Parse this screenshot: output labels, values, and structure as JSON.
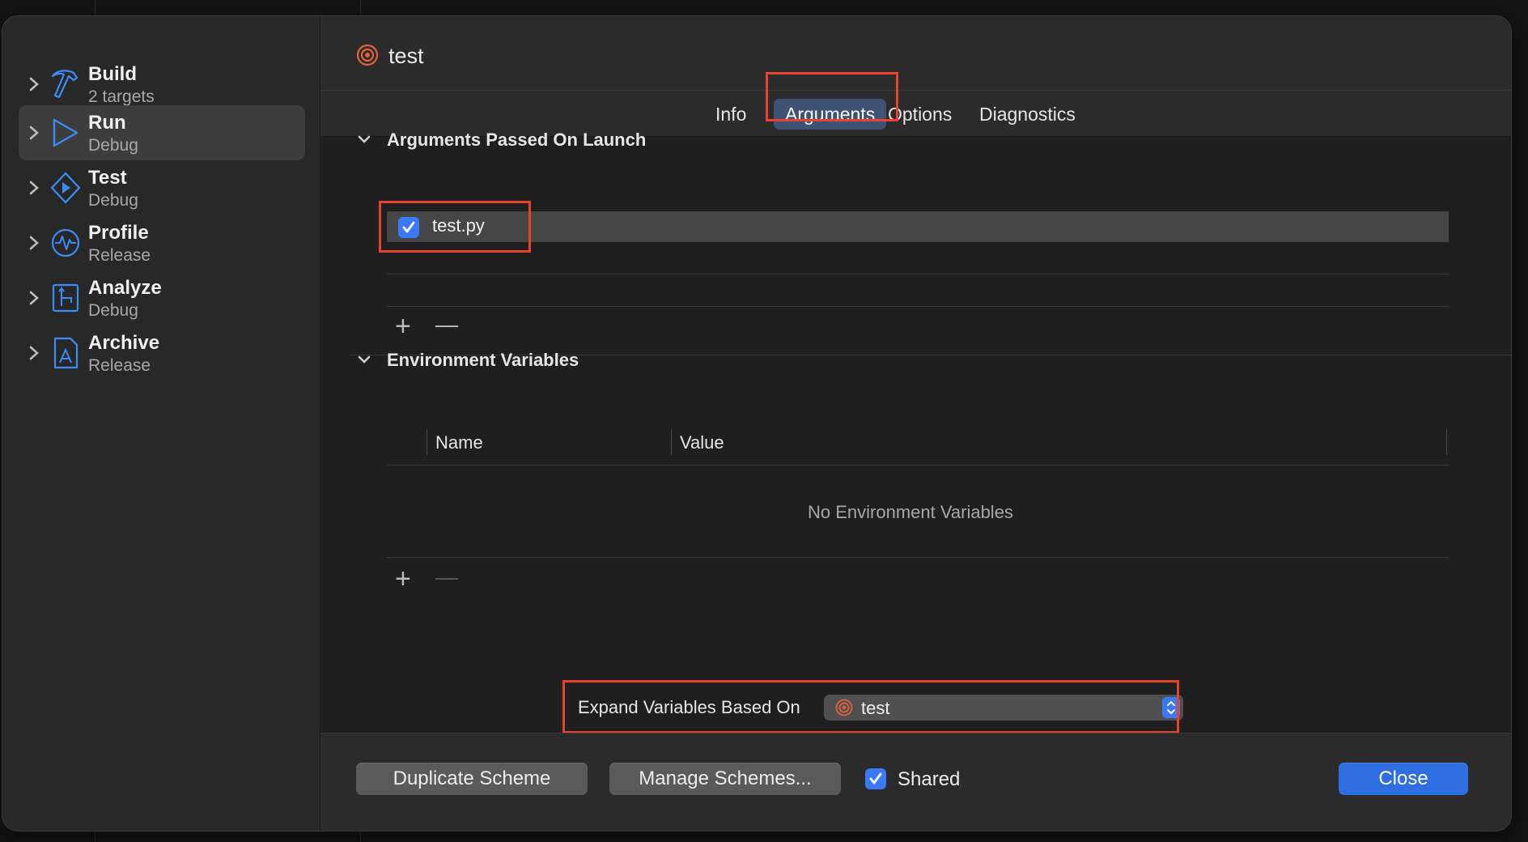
{
  "sidebar": {
    "items": [
      {
        "title": "Build",
        "subtitle": "2 targets",
        "icon": "hammer-icon"
      },
      {
        "title": "Run",
        "subtitle": "Debug",
        "icon": "play-triangle-icon"
      },
      {
        "title": "Test",
        "subtitle": "Debug",
        "icon": "test-diamond-icon"
      },
      {
        "title": "Profile",
        "subtitle": "Release",
        "icon": "instruments-gauge-icon"
      },
      {
        "title": "Analyze",
        "subtitle": "Debug",
        "icon": "analyze-branch-icon"
      },
      {
        "title": "Archive",
        "subtitle": "Release",
        "icon": "archive-app-icon"
      }
    ],
    "selected_index": 1
  },
  "header": {
    "title": "test",
    "icon": "target-icon"
  },
  "tabs": [
    {
      "label": "Info"
    },
    {
      "label": "Arguments"
    },
    {
      "label": "Options"
    },
    {
      "label": "Diagnostics"
    }
  ],
  "active_tab": "Arguments",
  "arguments": {
    "section_title": "Arguments Passed On Launch",
    "items": [
      {
        "checked": true,
        "value": "test.py"
      }
    ],
    "add_symbol": "+",
    "remove_symbol": "—"
  },
  "environment": {
    "section_title": "Environment Variables",
    "columns": [
      "Name",
      "Value"
    ],
    "empty_message": "No Environment Variables",
    "add_symbol": "+",
    "remove_symbol": "—"
  },
  "expand": {
    "label": "Expand Variables Based On",
    "selected": "test"
  },
  "footer": {
    "duplicate_label": "Duplicate Scheme",
    "manage_label": "Manage Schemes...",
    "shared_label": "Shared",
    "shared_checked": true,
    "close_label": "Close"
  },
  "colors": {
    "accent": "#3b7af6",
    "highlight": "#e8412c",
    "target_icon": "#e8603c"
  }
}
